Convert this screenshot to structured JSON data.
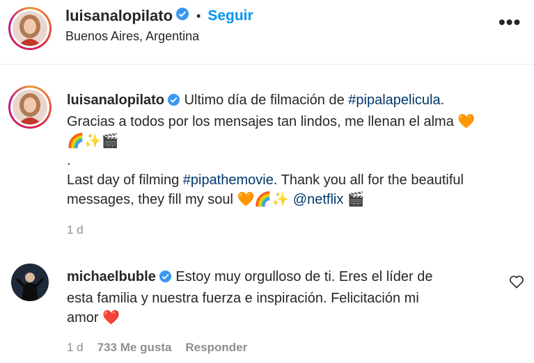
{
  "header": {
    "username": "luisanalopilato",
    "separator": "•",
    "follow_label": "Seguir",
    "location": "Buenos Aires, Argentina",
    "more_label": "•••"
  },
  "caption": {
    "username": "luisanalopilato",
    "line1_text": "Ultimo día de filmación de ",
    "line1_hashtag": "#pipalapelicula",
    "line1_end": ".",
    "line2": "Gracias a todos por los mensajes tan lindos, me llenan el alma 🧡",
    "line3": "🌈✨🎬",
    "line4": ".",
    "line5_text": "Last day of filming ",
    "line5_hashtag": "#pipathemovie",
    "line5_end": ". Thank you all for the beautiful",
    "line6_text": "messages, they fill my soul 🧡🌈✨ ",
    "line6_mention": "@netflix",
    "line6_end": " 🎬",
    "time": "1 d"
  },
  "comment": {
    "username": "michaelbuble",
    "line1": "Estoy muy orgulloso de ti. Eres el líder de",
    "line2": "esta familia y nuestra fuerza e inspiración. Felicitación mi",
    "line3": "amor ❤️",
    "time": "1 d",
    "likes": "733 Me gusta",
    "reply_label": "Responder"
  },
  "colors": {
    "link": "#00376b",
    "follow": "#0095f6",
    "verified": "#3897f0",
    "meta": "#8e8e8e"
  }
}
